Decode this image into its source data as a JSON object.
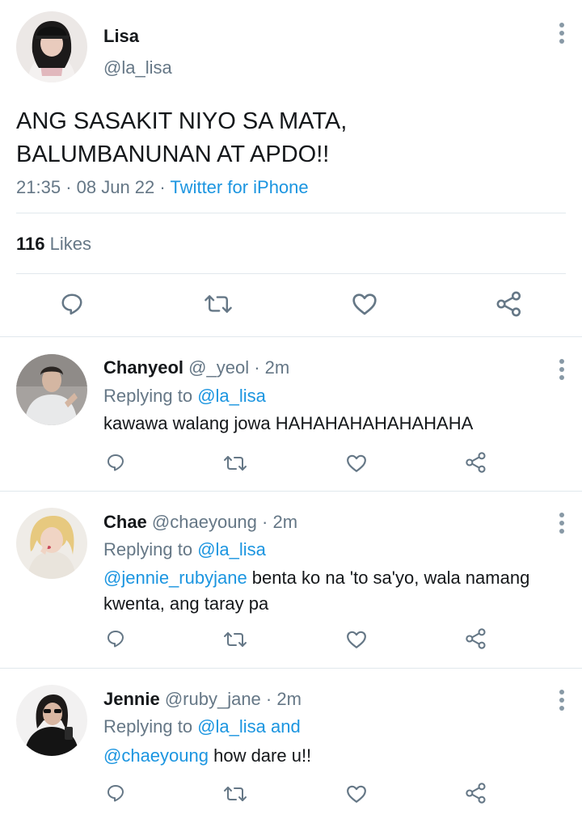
{
  "main_tweet": {
    "name": "Lisa",
    "handle": "@la_lisa",
    "text_line1": "ANG SASAKIT NIYO SA MATA,",
    "text_line2": "BALUMBANUNAN AT APDO!!",
    "time": "21:35",
    "date": "08 Jun 22",
    "source": "Twitter for iPhone",
    "dot": "·",
    "likes_count": "116",
    "likes_label": "Likes",
    "actions": [
      "reply-icon",
      "retweet-icon",
      "like-icon",
      "share-icon"
    ]
  },
  "replies": [
    {
      "name": "Chanyeol",
      "handle": "@_yeol",
      "time": "· 2m",
      "replying_prefix": "Replying to",
      "replying_to": "@la_lisa",
      "mention": "",
      "text": "kawawa walang jowa HAHAHAHAHAHAHAHA"
    },
    {
      "name": "Chae",
      "handle": "@chaeyoung",
      "time": "· 2m",
      "replying_prefix": "Replying to",
      "replying_to": "@la_lisa",
      "mention": "@jennie_rubyjane",
      "text": " benta ko na 'to sa'yo, wala namang kwenta, ang taray pa"
    },
    {
      "name": "Jennie",
      "handle": "@ruby_jane",
      "time": "· 2m",
      "replying_prefix": "Replying to",
      "replying_to": "@la_lisa and",
      "mention": "@chaeyoung",
      "text": " how dare u!!"
    }
  ],
  "colors": {
    "link": "#1b95e0",
    "muted": "#657786",
    "icon": "#657786",
    "divider": "#e1e8ed"
  }
}
